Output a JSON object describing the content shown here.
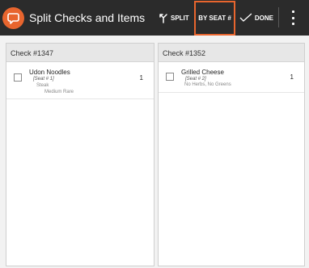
{
  "app": {
    "title": "Split Checks and Items",
    "accent_color": "#e8652e",
    "toolbar_color": "#2b2b2b",
    "logo_icon": "chat-bubble-logo"
  },
  "toolbar": {
    "split_label": "SPLIT",
    "split_icon": "split-arrows-icon",
    "by_seat_label": "BY SEAT #",
    "done_label": "DONE",
    "done_icon": "checkmark-icon",
    "overflow_icon": "more-vert-icon"
  },
  "checks": [
    {
      "title": "Check #1347",
      "items": [
        {
          "name": "Udon Noodles",
          "seat": "[Seat # 1]",
          "modifiers": [
            "Steak",
            "Medium Rare"
          ],
          "quantity": "1"
        }
      ]
    },
    {
      "title": "Check #1352",
      "items": [
        {
          "name": "Grilled Cheese",
          "seat": "[Seat # 2]",
          "modifiers": [
            "No Herbs, No Greens"
          ],
          "quantity": "1"
        }
      ]
    }
  ]
}
